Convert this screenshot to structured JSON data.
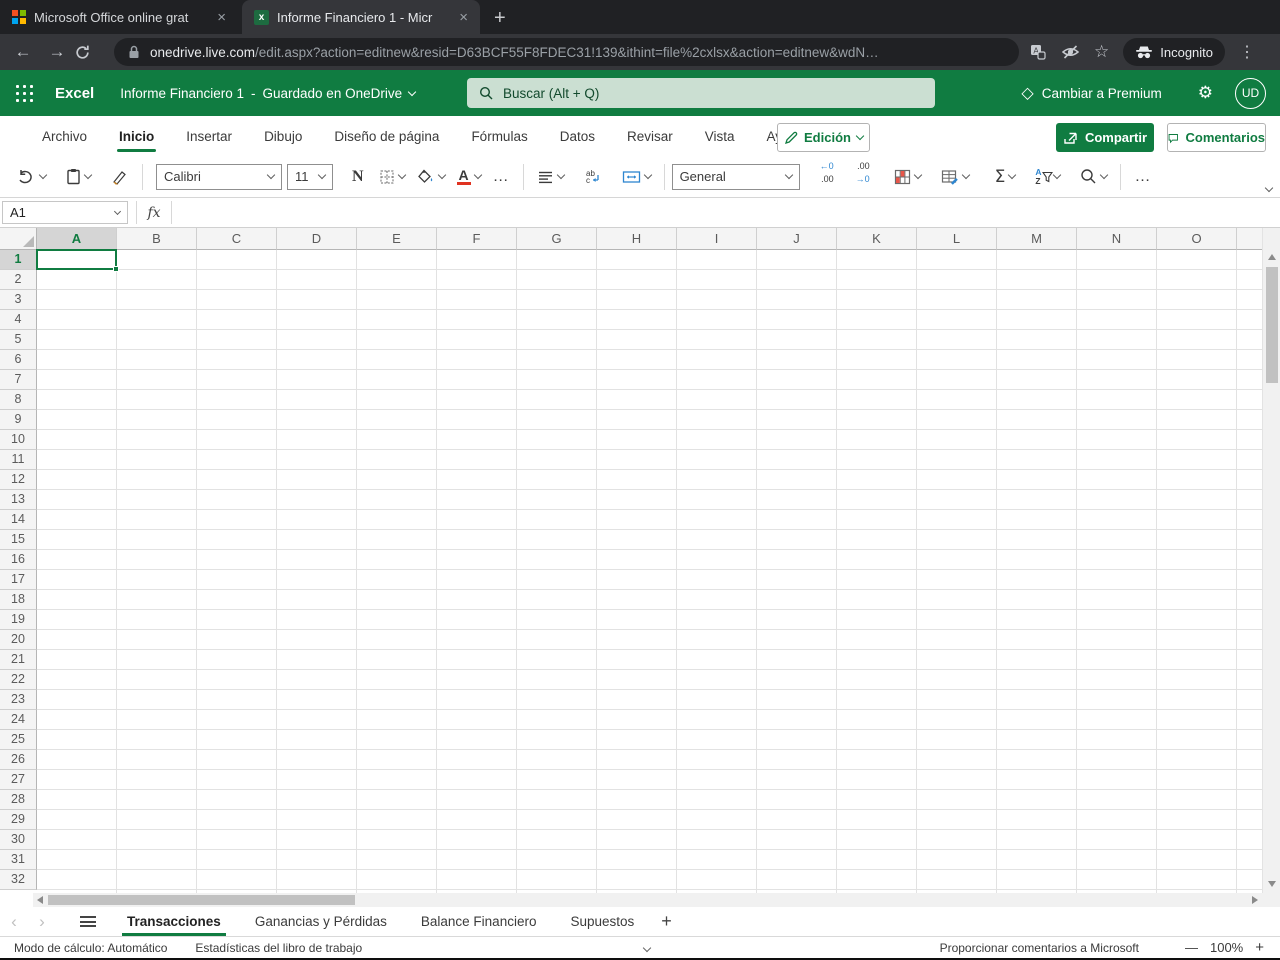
{
  "browser": {
    "tab1": {
      "title": "Microsoft Office online grat",
      "close": "×"
    },
    "tab2": {
      "title": "Informe Financiero 1 - Micr",
      "close": "×"
    },
    "tab2_favicon": "x",
    "new_tab": "+",
    "back": "←",
    "forward": "→",
    "url": {
      "host": "onedrive.live.com",
      "path": "/edit.aspx?action=editnew&resid=D63BCF55F8FDEC31!139&ithint=file%2cxlsx&action=editnew&wdN…"
    },
    "star": "☆",
    "incognito_label": "Incognito",
    "menu_dots": "⋮"
  },
  "header": {
    "app_name": "Excel",
    "doc_title": "Informe Financiero 1",
    "separator": "-",
    "save_status": "Guardado en OneDrive",
    "search_placeholder": "Buscar (Alt + Q)",
    "premium_diamond": "◇",
    "premium_label": "Cambiar a Premium",
    "gear": "⚙",
    "avatar_initials": "UD"
  },
  "ribbon": {
    "tabs": [
      "Archivo",
      "Inicio",
      "Insertar",
      "Dibujo",
      "Diseño de página",
      "Fórmulas",
      "Datos",
      "Revisar",
      "Vista",
      "Ayuda"
    ],
    "active_tab": "Inicio",
    "edit_mode_label": "Edición",
    "share_label": "Compartir",
    "comments_label": "Comentarios"
  },
  "toolbar": {
    "font_name": "Calibri",
    "font_size": "11",
    "bold_label": "N",
    "font_color_label": "A",
    "number_format": "General",
    "decrease_decimal": {
      "top": "←0",
      "bottom": ".00"
    },
    "increase_decimal": {
      "top": ".00",
      "bottom": "→0"
    },
    "autosum_label": "Σ",
    "sort_a": "A",
    "sort_z": "Z",
    "more_label": "…"
  },
  "formula_bar": {
    "name_box": "A1",
    "fx_label": "fx",
    "value": ""
  },
  "grid": {
    "columns": [
      "A",
      "B",
      "C",
      "D",
      "E",
      "F",
      "G",
      "H",
      "I",
      "J",
      "K",
      "L",
      "M",
      "N",
      "O"
    ],
    "selected_column": "A",
    "rows": [
      "1",
      "2",
      "3",
      "4",
      "5",
      "6",
      "7",
      "8",
      "9",
      "10",
      "11",
      "12",
      "13",
      "14",
      "15",
      "16",
      "17",
      "18",
      "19",
      "20",
      "21",
      "22",
      "23",
      "24",
      "25",
      "26",
      "27",
      "28",
      "29",
      "30",
      "31",
      "32"
    ],
    "selected_row": "1",
    "selected_cell": "A1"
  },
  "sheets": {
    "prev": "‹",
    "next": "›",
    "tabs": [
      "Transacciones",
      "Ganancias y Pérdidas",
      "Balance Financiero",
      "Supuestos"
    ],
    "active": "Transacciones",
    "add_label": "+"
  },
  "status_bar": {
    "calc_mode": "Modo de cálculo: Automático",
    "workbook_stats": "Estadísticas del libro de trabajo",
    "feedback": "Proporcionar comentarios a Microsoft",
    "zoom_out": "—",
    "zoom_level": "100%",
    "zoom_in": "+"
  },
  "colors": {
    "excel_green": "#107C41",
    "chrome_dark": "#202124",
    "chrome_toolbar": "#35363A",
    "search_box_bg": "#CBDFD2",
    "font_color_red": "#E03321",
    "accent_blue": "#2E86D0"
  },
  "icons": [
    "microsoft-logo",
    "excel-favicon",
    "close-icon",
    "new-tab-icon",
    "back-icon",
    "forward-icon",
    "reload-icon",
    "lock-icon",
    "translate-icon",
    "eye-off-icon",
    "star-icon",
    "incognito-icon",
    "menu-dots-icon",
    "waffle-icon",
    "search-icon",
    "chevron-down-icon",
    "diamond-icon",
    "gear-icon",
    "pencil-icon",
    "share-icon",
    "comment-icon",
    "undo-icon",
    "paste-icon",
    "format-painter-icon",
    "borders-icon",
    "fill-color-icon",
    "font-color-icon",
    "align-icon",
    "wrap-text-icon",
    "merge-cells-icon",
    "decrease-decimal-icon",
    "increase-decimal-icon",
    "conditional-format-icon",
    "format-table-icon",
    "autosum-icon",
    "sort-filter-icon",
    "find-icon",
    "select-all-corner",
    "fill-handle"
  ]
}
